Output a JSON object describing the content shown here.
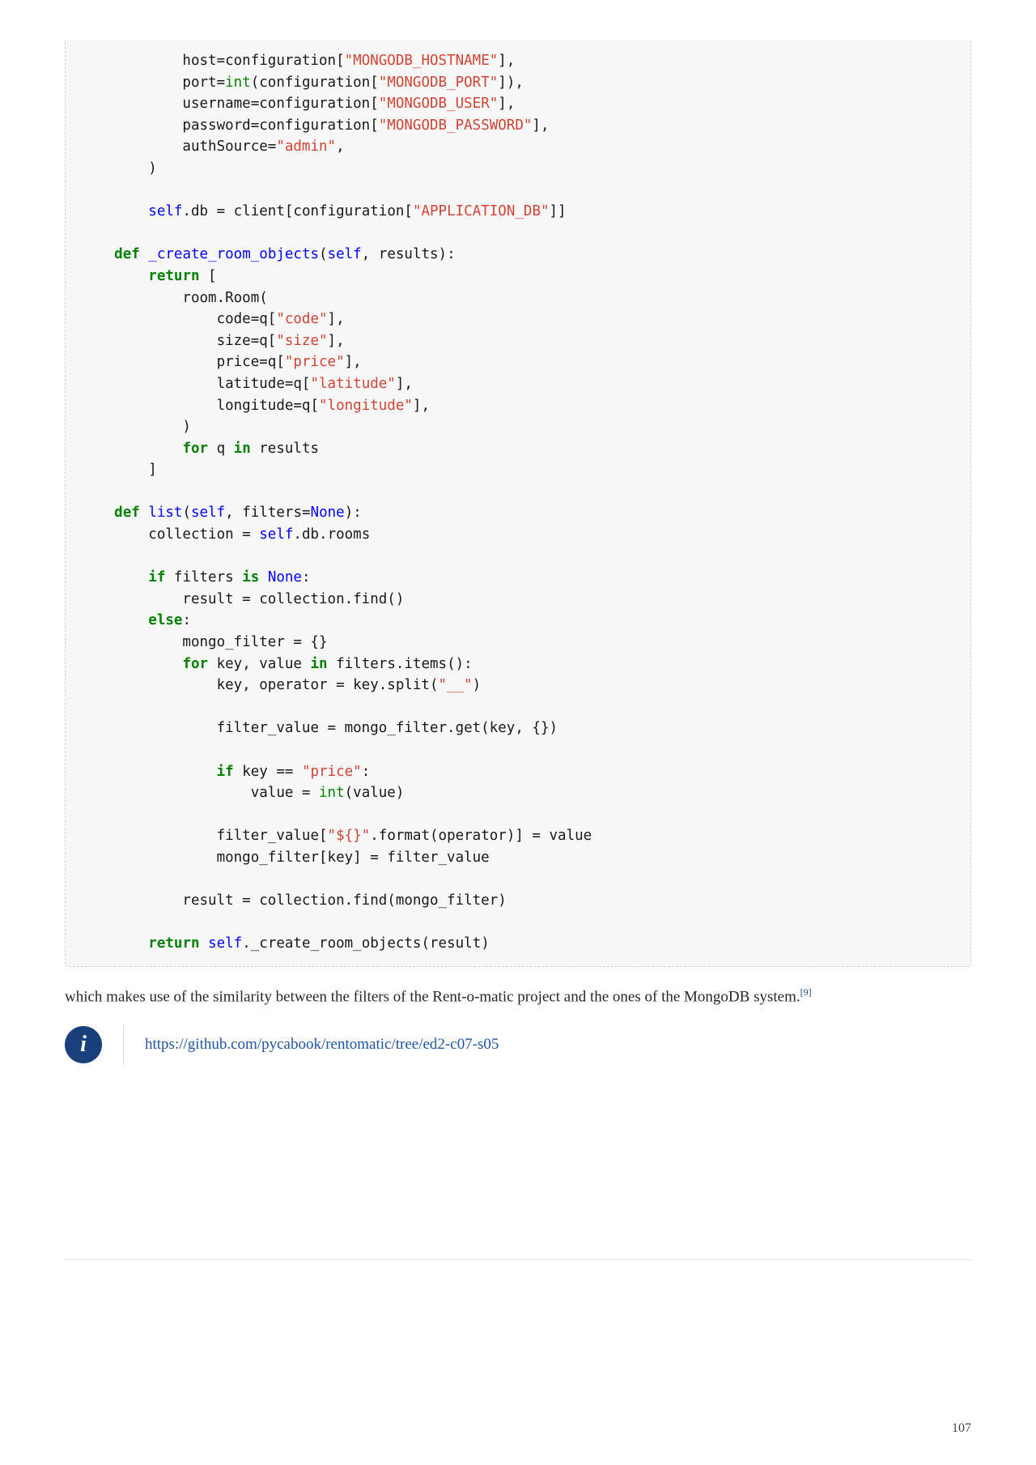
{
  "code": {
    "lines": [
      [
        [
          "            host=configuration[",
          "plain"
        ],
        [
          "\"MONGODB_HOSTNAME\"",
          "str"
        ],
        [
          "],",
          "plain"
        ]
      ],
      [
        [
          "            port=",
          "plain"
        ],
        [
          "int",
          "builtin"
        ],
        [
          "(configuration[",
          "plain"
        ],
        [
          "\"MONGODB_PORT\"",
          "str"
        ],
        [
          "]),",
          "plain"
        ]
      ],
      [
        [
          "            username=configuration[",
          "plain"
        ],
        [
          "\"MONGODB_USER\"",
          "str"
        ],
        [
          "],",
          "plain"
        ]
      ],
      [
        [
          "            password=configuration[",
          "plain"
        ],
        [
          "\"MONGODB_PASSWORD\"",
          "str"
        ],
        [
          "],",
          "plain"
        ]
      ],
      [
        [
          "            authSource=",
          "plain"
        ],
        [
          "\"admin\"",
          "str"
        ],
        [
          ",",
          "plain"
        ]
      ],
      [
        [
          "        )",
          "plain"
        ]
      ],
      [
        [
          "",
          "plain"
        ]
      ],
      [
        [
          "        ",
          "plain"
        ],
        [
          "self",
          "blue"
        ],
        [
          ".db = client[configuration[",
          "plain"
        ],
        [
          "\"APPLICATION_DB\"",
          "str"
        ],
        [
          "]]",
          "plain"
        ]
      ],
      [
        [
          "",
          "plain"
        ]
      ],
      [
        [
          "    ",
          "plain"
        ],
        [
          "def",
          "kw"
        ],
        [
          " ",
          "plain"
        ],
        [
          "_create_room_objects",
          "blue"
        ],
        [
          "(",
          "plain"
        ],
        [
          "self",
          "blue"
        ],
        [
          ", results):",
          "plain"
        ]
      ],
      [
        [
          "        ",
          "plain"
        ],
        [
          "return",
          "kw"
        ],
        [
          " [",
          "plain"
        ]
      ],
      [
        [
          "            room.Room(",
          "plain"
        ]
      ],
      [
        [
          "                code=q[",
          "plain"
        ],
        [
          "\"code\"",
          "str"
        ],
        [
          "],",
          "plain"
        ]
      ],
      [
        [
          "                size=q[",
          "plain"
        ],
        [
          "\"size\"",
          "str"
        ],
        [
          "],",
          "plain"
        ]
      ],
      [
        [
          "                price=q[",
          "plain"
        ],
        [
          "\"price\"",
          "str"
        ],
        [
          "],",
          "plain"
        ]
      ],
      [
        [
          "                latitude=q[",
          "plain"
        ],
        [
          "\"latitude\"",
          "str"
        ],
        [
          "],",
          "plain"
        ]
      ],
      [
        [
          "                longitude=q[",
          "plain"
        ],
        [
          "\"longitude\"",
          "str"
        ],
        [
          "],",
          "plain"
        ]
      ],
      [
        [
          "            )",
          "plain"
        ]
      ],
      [
        [
          "            ",
          "plain"
        ],
        [
          "for",
          "kw"
        ],
        [
          " q ",
          "plain"
        ],
        [
          "in",
          "kw"
        ],
        [
          " results",
          "plain"
        ]
      ],
      [
        [
          "        ]",
          "plain"
        ]
      ],
      [
        [
          "",
          "plain"
        ]
      ],
      [
        [
          "    ",
          "plain"
        ],
        [
          "def",
          "kw"
        ],
        [
          " ",
          "plain"
        ],
        [
          "list",
          "blue"
        ],
        [
          "(",
          "plain"
        ],
        [
          "self",
          "blue"
        ],
        [
          ", filters=",
          "plain"
        ],
        [
          "None",
          "blue"
        ],
        [
          "):",
          "plain"
        ]
      ],
      [
        [
          "        collection = ",
          "plain"
        ],
        [
          "self",
          "blue"
        ],
        [
          ".db.rooms",
          "plain"
        ]
      ],
      [
        [
          "",
          "plain"
        ]
      ],
      [
        [
          "        ",
          "plain"
        ],
        [
          "if",
          "kw"
        ],
        [
          " filters ",
          "plain"
        ],
        [
          "is",
          "kw"
        ],
        [
          " ",
          "plain"
        ],
        [
          "None",
          "blue"
        ],
        [
          ":",
          "plain"
        ]
      ],
      [
        [
          "            result = collection.find()",
          "plain"
        ]
      ],
      [
        [
          "        ",
          "plain"
        ],
        [
          "else",
          "kw"
        ],
        [
          ":",
          "plain"
        ]
      ],
      [
        [
          "            mongo_filter = {}",
          "plain"
        ]
      ],
      [
        [
          "            ",
          "plain"
        ],
        [
          "for",
          "kw"
        ],
        [
          " key, value ",
          "plain"
        ],
        [
          "in",
          "kw"
        ],
        [
          " filters.items():",
          "plain"
        ]
      ],
      [
        [
          "                key, operator = key.split(",
          "plain"
        ],
        [
          "\"__\"",
          "str"
        ],
        [
          ")",
          "plain"
        ]
      ],
      [
        [
          "",
          "plain"
        ]
      ],
      [
        [
          "                filter_value = mongo_filter.get(key, {})",
          "plain"
        ]
      ],
      [
        [
          "",
          "plain"
        ]
      ],
      [
        [
          "                ",
          "plain"
        ],
        [
          "if",
          "kw"
        ],
        [
          " key == ",
          "plain"
        ],
        [
          "\"price\"",
          "str"
        ],
        [
          ":",
          "plain"
        ]
      ],
      [
        [
          "                    value = ",
          "plain"
        ],
        [
          "int",
          "builtin"
        ],
        [
          "(value)",
          "plain"
        ]
      ],
      [
        [
          "",
          "plain"
        ]
      ],
      [
        [
          "                filter_value[",
          "plain"
        ],
        [
          "\"$",
          "str"
        ],
        [
          "{}",
          "str"
        ],
        [
          "\"",
          "str"
        ],
        [
          ".format(operator)] = value",
          "plain"
        ]
      ],
      [
        [
          "                mongo_filter[key] = filter_value",
          "plain"
        ]
      ],
      [
        [
          "",
          "plain"
        ]
      ],
      [
        [
          "            result = collection.find(mongo_filter)",
          "plain"
        ]
      ],
      [
        [
          "",
          "plain"
        ]
      ],
      [
        [
          "        ",
          "plain"
        ],
        [
          "return",
          "kw"
        ],
        [
          " ",
          "plain"
        ],
        [
          "self",
          "blue"
        ],
        [
          "._create_room_objects(result)",
          "plain"
        ]
      ]
    ]
  },
  "paragraph": {
    "text_before": "which makes use of the similarity between the filters of the Rent-o-matic project and the ones of the MongoDB system.",
    "footnote": "[9]"
  },
  "admon": {
    "icon_glyph": "i",
    "link_text": "https://github.com/pycabook/rentomatic/tree/ed2-c07-s05"
  },
  "page_number": "107"
}
